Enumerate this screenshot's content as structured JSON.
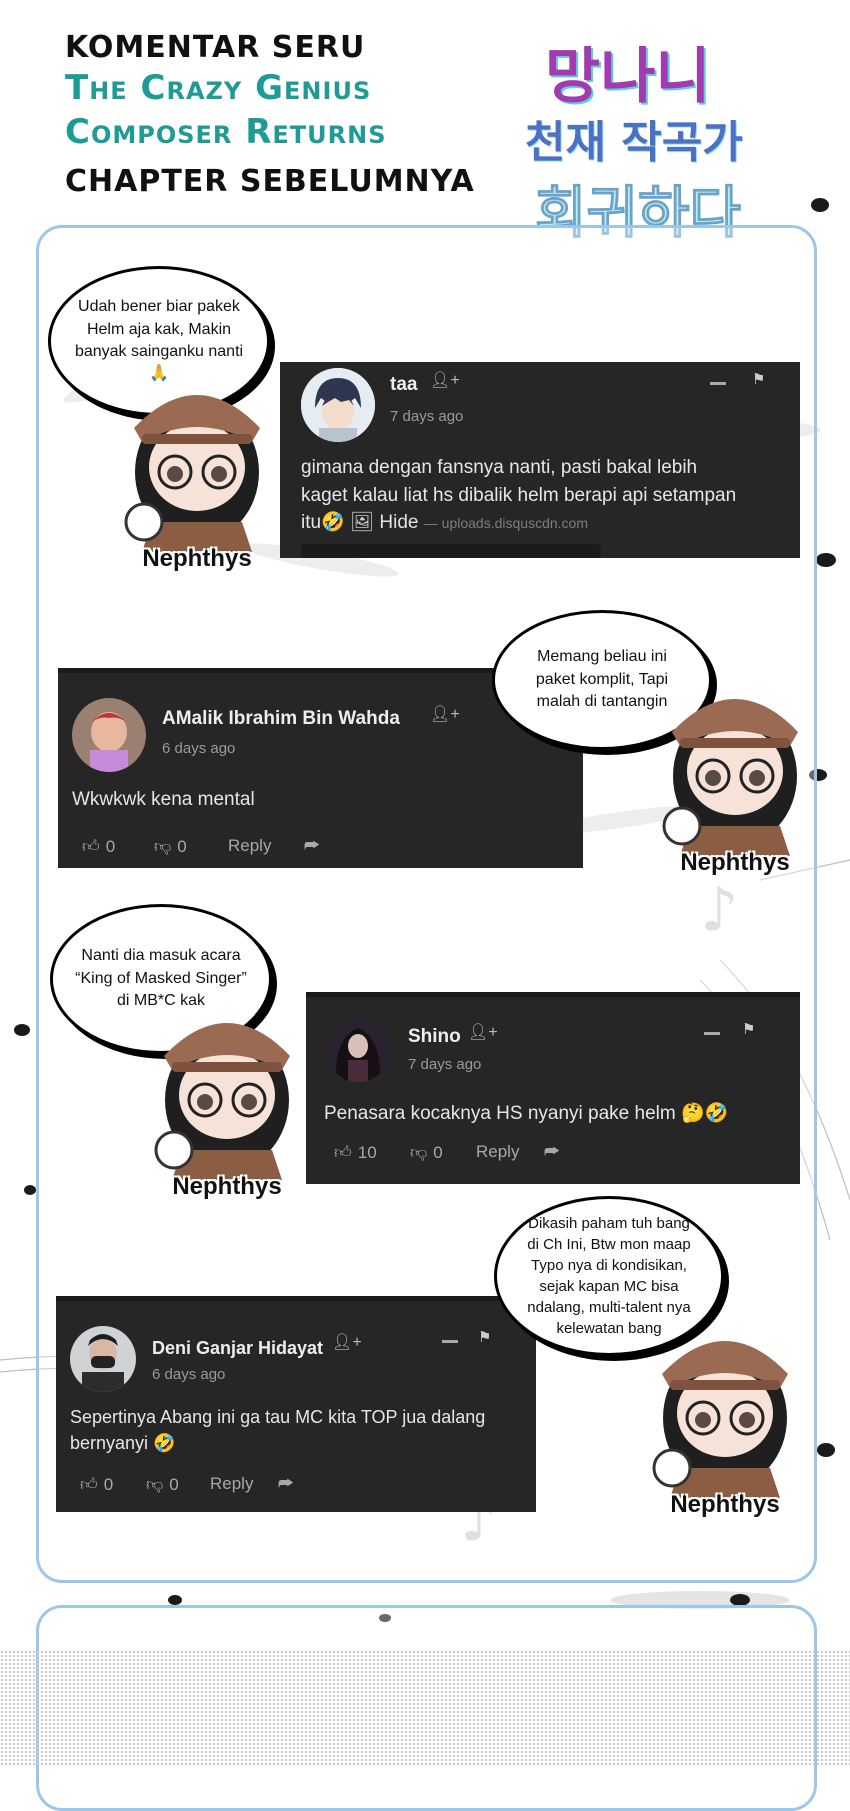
{
  "header": {
    "line1": "KOMENTAR SERU",
    "line2": "The Crazy Genius",
    "line3": "Composer Returns",
    "line4": "CHAPTER SEBELUMNYA",
    "logo_line1": "망나니",
    "logo_line2": "천재 작곡가",
    "logo_line3": "회귀하다"
  },
  "mascot_name": "Nephthys",
  "bubbles": [
    "Udah bener biar pakek Helm aja kak, Makin banyak sainganku nanti 🙏",
    "Memang beliau ini paket komplit, Tapi malah di tantangin",
    "Nanti dia masuk acara “King of Masked Singer” di MB*C kak",
    "Dikasih paham tuh bang di Ch Ini, Btw mon maap Typo nya di kondisikan, sejak kapan MC bisa ndalang, multi-talent nya kelewatan bang"
  ],
  "comments": [
    {
      "user": "taa",
      "time": "7 days ago",
      "text": "gimana dengan fansnya nanti, pasti bakal lebih kaget kalau liat hs dibalik helm berapi api setampan itu🤣",
      "hide": "Hide",
      "source": "— uploads.disquscdn.com"
    },
    {
      "user": "AMalik Ibrahim Bin Wahda",
      "time": "6 days ago",
      "text": "Wkwkwk kena mental",
      "up": "0",
      "down": "0",
      "reply": "Reply"
    },
    {
      "user": "Shino",
      "time": "7 days ago",
      "text": "Penasara kocaknya HS nyanyi pake helm 🤔🤣",
      "up": "10",
      "down": "0",
      "reply": "Reply"
    },
    {
      "user": "Deni Ganjar Hidayat",
      "time": "6 days ago",
      "text": "Sepertinya Abang ini ga tau MC kita TOP jua dalang bernyanyi 🤣",
      "up": "0",
      "down": "0",
      "reply": "Reply"
    }
  ],
  "colors": {
    "teal": "#1e9b95",
    "panel_border": "#9cc6ea",
    "card_bg": "#262626"
  }
}
